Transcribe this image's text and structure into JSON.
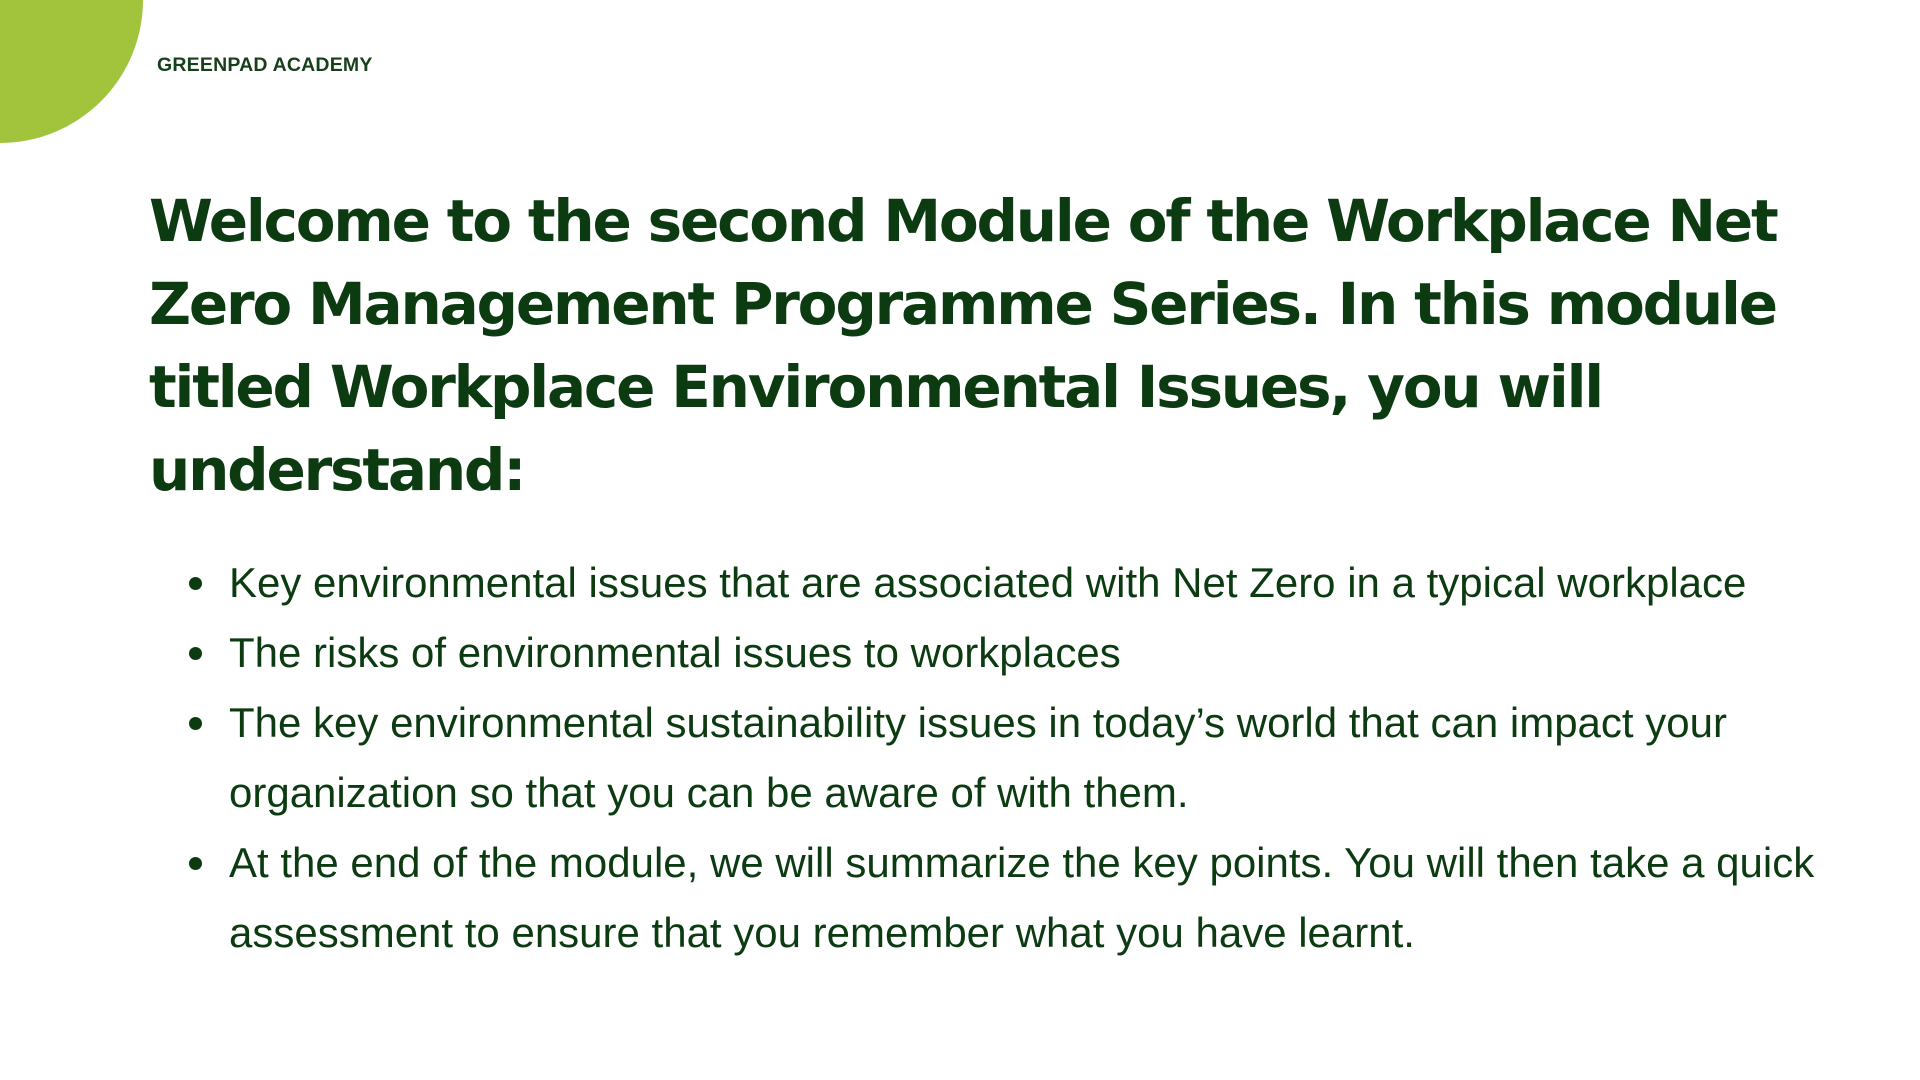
{
  "brand": {
    "name": "GREENPAD ACADEMY",
    "accent_color": "#a2c33c"
  },
  "heading": {
    "text": "Welcome to the second Module of the Workplace Net Zero Management Programme Series. In this module titled Workplace Environmental Issues, you will understand:"
  },
  "bullets": [
    {
      "text": "Key environmental issues that are associated with Net Zero in a typical workplace"
    },
    {
      "text": "The risks of environmental issues to workplaces"
    },
    {
      "text": "The key environmental sustainability issues in today’s world that can impact your organization so that you can be aware of with them."
    },
    {
      "text": "At the end of the module, we will summarize the key points. You will then take a quick assessment to ensure that you remember what you have learnt."
    }
  ],
  "colors": {
    "text": "#0c3b12",
    "background": "#ffffff"
  }
}
